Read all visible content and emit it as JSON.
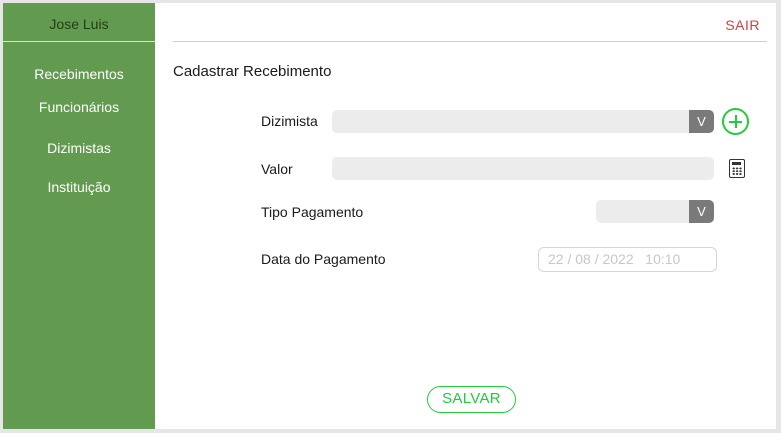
{
  "sidebar": {
    "user_name": "Jose Luis",
    "items": [
      {
        "label": "Recebimentos"
      },
      {
        "label": "Funcionários"
      },
      {
        "label": "Dizimistas"
      },
      {
        "label": "Instituição"
      }
    ]
  },
  "header": {
    "logout_label": "SAIR"
  },
  "form": {
    "title": "Cadastrar Recebimento",
    "dizimista": {
      "label": "Dizimista",
      "value": "",
      "dropdown_glyph": "V"
    },
    "valor": {
      "label": "Valor",
      "value": ""
    },
    "tipo_pagamento": {
      "label": "Tipo Pagamento",
      "value": "",
      "dropdown_glyph": "V"
    },
    "data_pagamento": {
      "label": "Data do Pagamento",
      "value": "22 / 08 / 2022   10:10"
    },
    "save_label": "SALVAR"
  },
  "icons": {
    "add": "plus-circle-icon",
    "calculator": "calculator-icon"
  },
  "colors": {
    "sidebar_bg": "#629b4f",
    "accent_green": "#22cc3a",
    "logout_red": "#cc4444"
  }
}
